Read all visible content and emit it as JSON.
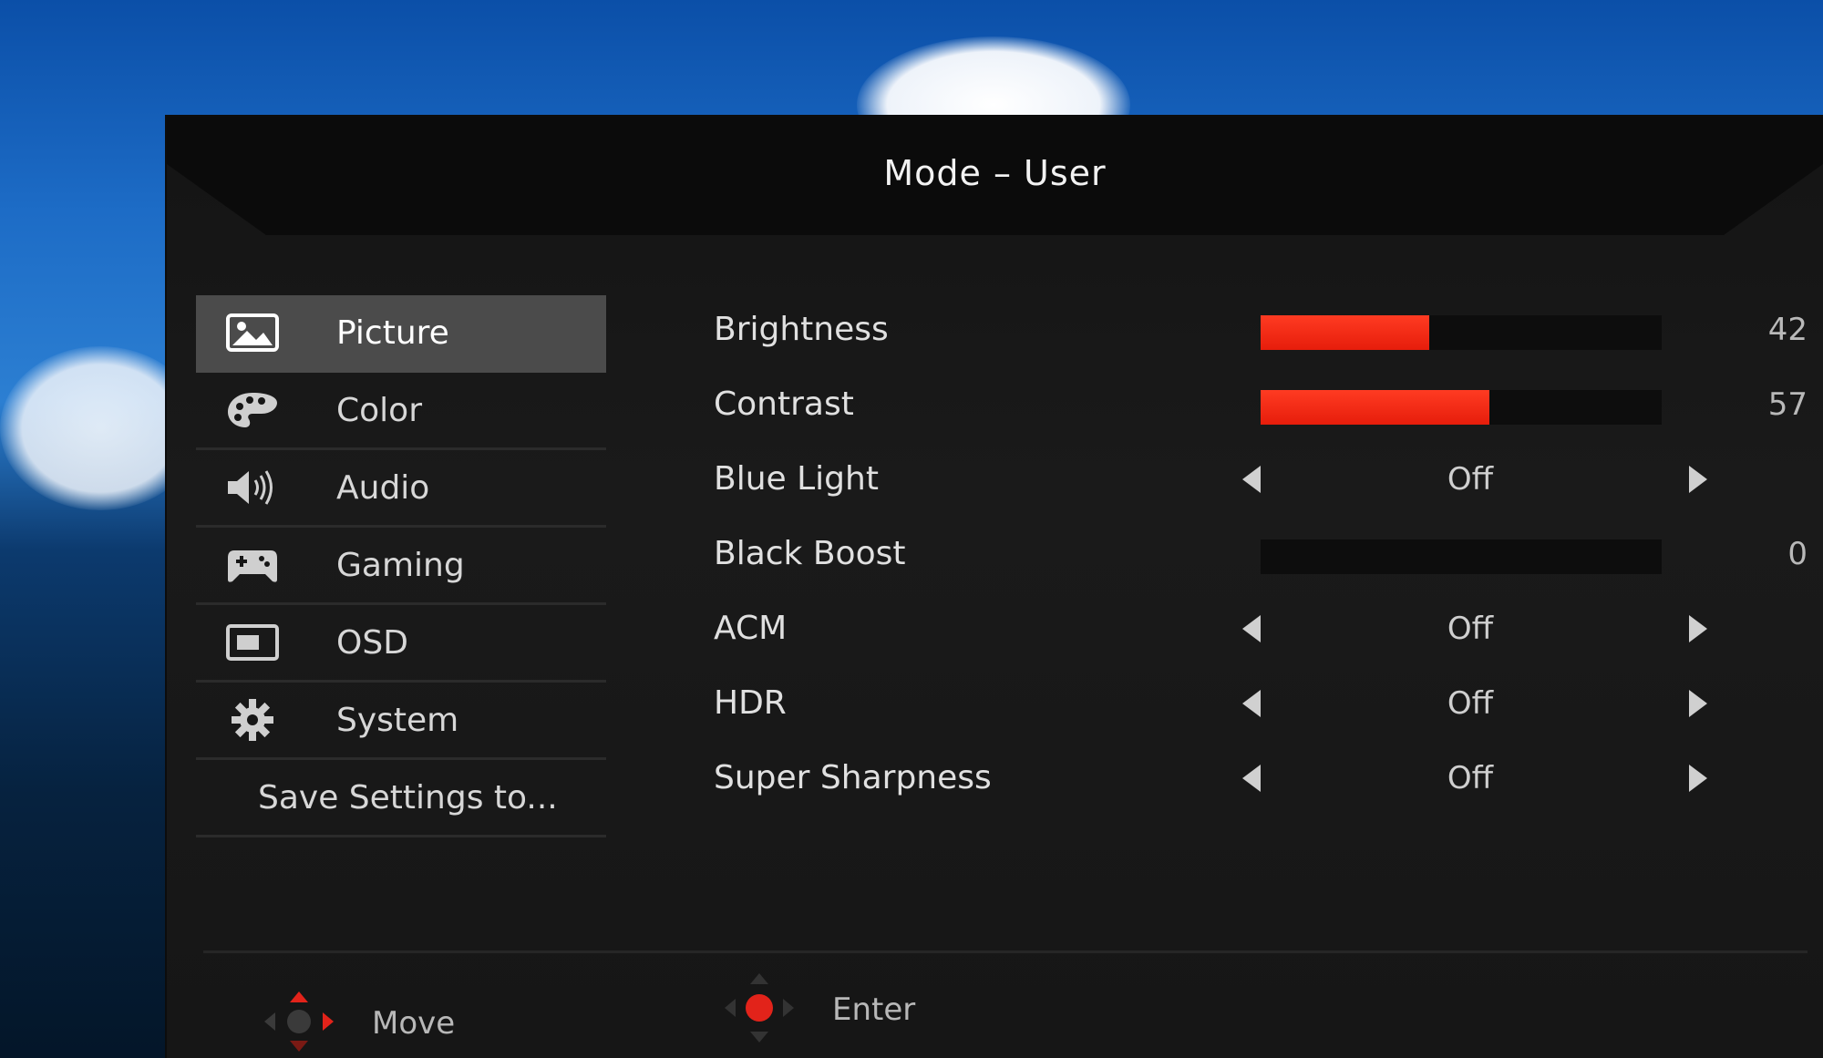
{
  "title": "Mode – User",
  "sidebar": {
    "items": [
      {
        "label": "Picture",
        "icon": "picture-icon",
        "active": true
      },
      {
        "label": "Color",
        "icon": "palette-icon",
        "active": false
      },
      {
        "label": "Audio",
        "icon": "speaker-icon",
        "active": false
      },
      {
        "label": "Gaming",
        "icon": "gamepad-icon",
        "active": false
      },
      {
        "label": "OSD",
        "icon": "osd-window-icon",
        "active": false
      },
      {
        "label": "System",
        "icon": "gear-icon",
        "active": false
      },
      {
        "label": "Save Settings to...",
        "icon": "",
        "active": false
      }
    ]
  },
  "settings": {
    "brightness": {
      "label": "Brightness",
      "value": "42",
      "level": 42
    },
    "contrast": {
      "label": "Contrast",
      "value": "57",
      "level": 57
    },
    "blue_light": {
      "label": "Blue Light",
      "value": "Off"
    },
    "black_boost": {
      "label": "Black Boost",
      "value": "0",
      "level": 0
    },
    "acm": {
      "label": "ACM",
      "value": "Off"
    },
    "hdr": {
      "label": "HDR",
      "value": "Off"
    },
    "super_sharpness": {
      "label": "Super Sharpness",
      "value": "Off"
    }
  },
  "footer": {
    "move_label": "Move",
    "enter_label": "Enter"
  },
  "colors": {
    "accent": "#ff2a12",
    "panel": "#181818",
    "active_item": "#4b4b4b"
  }
}
